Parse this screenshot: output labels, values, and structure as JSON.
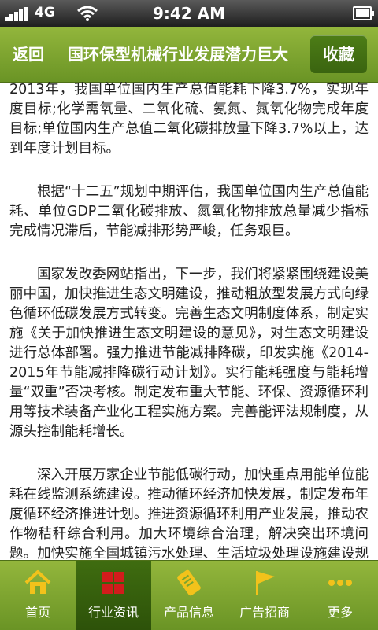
{
  "status_bar": {
    "network": "4G",
    "time": "9:42 AM"
  },
  "header": {
    "back_label": "返回",
    "title": "国环保型机械行业发展潜力巨大",
    "favorite_label": "收藏"
  },
  "article": {
    "paragraphs": [
      "2013年，我国单位国内生产总值能耗下降3.7%，实现年度目标;化学需氧量、二氧化硫、氨氮、氮氧化物完成年度目标;单位国内生产总值二氧化碳排放量下降3.7%以上，达到年度计划目标。",
      "根据“十二五”规划中期评估，我国单位国内生产总值能耗、单位GDP二氧化碳排放、氮氧化物排放总量减少指标完成情况滞后，节能减排形势严峻，任务艰巨。",
      "国家发改委网站指出，下一步，我们将紧紧围绕建设美丽中国，加快推进生态文明建设，推动粗放型发展方式向绿色循环低碳发展方式转变。完善生态文明制度体系，制定实施《关于加快推进生态文明建设的意见》，对生态文明建设进行总体部署。强力推进节能减排降碳，印发实施《2014-2015年节能减排降碳行动计划》。实行能耗强度与能耗增量“双重”否决考核。制定发布重大节能、环保、资源循环利用等技术装备产业化工程实施方案。完善能评法规制度，从源头控制能耗增长。",
      "深入开展万家企业节能低碳行动，加快重点用能单位能耗在线监测系统建设。推动循环经济加快发展，制定发布年度循环经济推进计划。推进资源循环利用产业发展，推动农作物秸秆综合利用。加大环境综合治理，解决突出环境问题。加快实施全国城镇污水处理、生活垃圾处理设施建设规划。深入开展节能减排全民行动。倡导崇尚文明节约、反对奢侈浪费的社会风尚。积极推动各项政策措施"
    ]
  },
  "bottom_nav": {
    "items": [
      {
        "label": "首页",
        "icon": "home-icon"
      },
      {
        "label": "行业资讯",
        "icon": "news-grid-icon"
      },
      {
        "label": "产品信息",
        "icon": "product-tag-icon"
      },
      {
        "label": "广告招商",
        "icon": "flag-icon"
      },
      {
        "label": "更多",
        "icon": "more-dots-icon"
      }
    ],
    "active_index": 1
  },
  "colors": {
    "accent_green": "#7ba52f",
    "active_tab": "#3a6410",
    "icon_yellow": "#f2c21b",
    "icon_red": "#d21c1c"
  }
}
